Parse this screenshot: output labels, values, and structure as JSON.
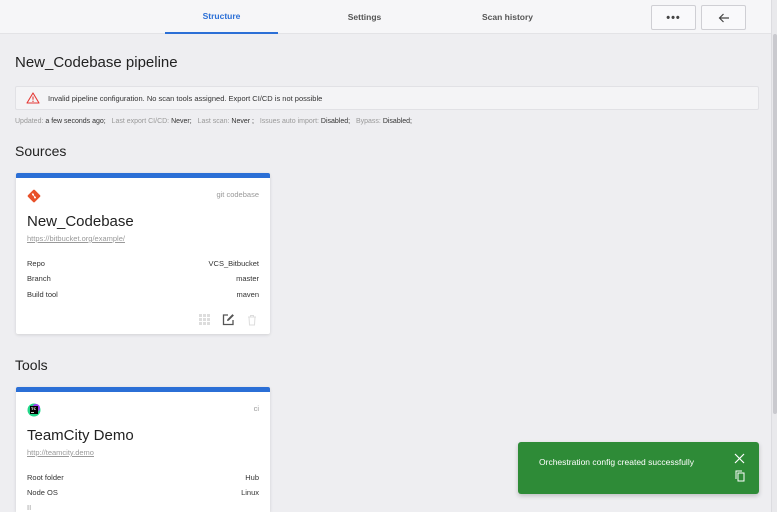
{
  "tabs": [
    {
      "label": "Structure",
      "active": true
    },
    {
      "label": "Settings",
      "active": false
    },
    {
      "label": "Scan history",
      "active": false
    }
  ],
  "toolbar": {
    "more_label": "•••",
    "back_icon": "arrow-left-icon"
  },
  "page": {
    "title": "New_Codebase pipeline"
  },
  "alert": {
    "icon": "warning-triangle-icon",
    "color": "#e53935",
    "text": "Invalid pipeline configuration. No scan tools assigned. Export CI/CD is not possible"
  },
  "meta": {
    "updated_label": "Updated:",
    "updated_value": "a few seconds ago;",
    "last_export_label": "Last export CI/CD:",
    "last_export_value": "Never;",
    "last_scan_label": "Last scan:",
    "last_scan_value": "Never ;",
    "issues_label": "Issues auto import:",
    "issues_value": "Disabled;",
    "bypass_label": "Bypass:",
    "bypass_value": "Disabled;"
  },
  "sources": {
    "title": "Sources",
    "card": {
      "kind": "git codebase",
      "logo_icon": "git-icon",
      "name": "New_Codebase",
      "url": "https://bitbucket.org/example/",
      "rows": [
        {
          "key": "Repo",
          "value": "VCS_Bitbucket"
        },
        {
          "key": "Branch",
          "value": "master"
        },
        {
          "key": "Build tool",
          "value": "maven"
        }
      ],
      "actions": [
        "grid-icon",
        "edit-icon",
        "trash-icon"
      ]
    }
  },
  "tools": {
    "title": "Tools",
    "card": {
      "kind": "ci",
      "logo_icon": "teamcity-icon",
      "name": "TeamCity Demo",
      "url": "http://teamcity.demo",
      "rows": [
        {
          "key": "Root folder",
          "value": "Hub"
        },
        {
          "key": "Node OS",
          "value": "Linux"
        },
        {
          "key": "II",
          "value": ""
        }
      ]
    }
  },
  "toast": {
    "message": "Orchestration config created successfully",
    "color": "#2e8b37",
    "close_icon": "close-icon",
    "copy_icon": "copy-icon"
  },
  "colors": {
    "accent": "#2b6fd6",
    "background": "#eeeef1"
  }
}
